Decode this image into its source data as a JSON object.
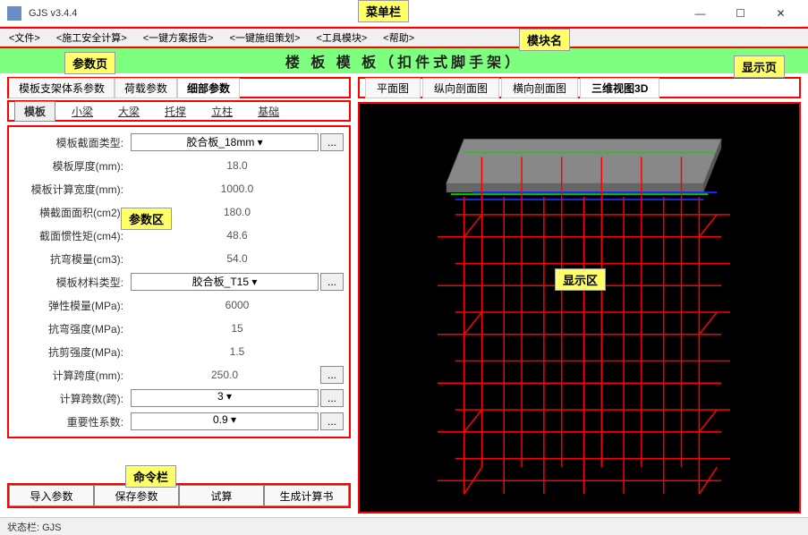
{
  "app": {
    "title": "GJS v3.4.4"
  },
  "window_controls": {
    "min": "—",
    "max": "☐",
    "close": "✕"
  },
  "menubar": {
    "items": [
      "<文件>",
      "<施工安全计算>",
      "<一键方案报告>",
      "<一键施组策划>",
      "<工具模块>",
      "<帮助>"
    ]
  },
  "module_name": "楼 板 模 板（扣件式脚手架）",
  "callouts": {
    "menubar": "菜单栏",
    "module_name": "模块名",
    "param_page": "参数页",
    "display_page": "显示页",
    "param_area": "参数区",
    "display_area": "显示区",
    "command_bar": "命令栏"
  },
  "param_tabs": {
    "items": [
      "模板支架体系参数",
      "荷载参数",
      "细部参数"
    ],
    "active": 2
  },
  "sub_tabs": {
    "items": [
      "模板",
      "小梁",
      "大梁",
      "托撑",
      "立柱",
      "基础"
    ],
    "active": 0
  },
  "params": {
    "rows": [
      {
        "label": "模板截面类型:",
        "value": "胶合板_18mm",
        "type": "select_dots"
      },
      {
        "label": "模板厚度(mm):",
        "value": "18.0",
        "type": "text"
      },
      {
        "label": "模板计算宽度(mm):",
        "value": "1000.0",
        "type": "text"
      },
      {
        "label": "横截面面积(cm2):",
        "value": "180.0",
        "type": "text"
      },
      {
        "label": "截面惯性矩(cm4):",
        "value": "48.6",
        "type": "text"
      },
      {
        "label": "抗弯模量(cm3):",
        "value": "54.0",
        "type": "text"
      },
      {
        "label": "模板材料类型:",
        "value": "胶合板_T15",
        "type": "select_dots"
      },
      {
        "label": "弹性模量(MPa):",
        "value": "6000",
        "type": "text"
      },
      {
        "label": "抗弯强度(MPa):",
        "value": "15",
        "type": "text"
      },
      {
        "label": "抗剪强度(MPa):",
        "value": "1.5",
        "type": "text"
      },
      {
        "label": "计算跨度(mm):",
        "value": "250.0",
        "type": "text_dots"
      },
      {
        "label": "计算跨数(跨):",
        "value": "3",
        "type": "select_dots"
      },
      {
        "label": "重要性系数:",
        "value": "0.9",
        "type": "select_dots"
      }
    ]
  },
  "commands": {
    "items": [
      "导入参数",
      "保存参数",
      "试算",
      "生成计算书"
    ]
  },
  "view_tabs": {
    "items": [
      "平面图",
      "纵向剖面图",
      "横向剖面图",
      "三维视图3D"
    ],
    "active": 3
  },
  "statusbar": {
    "text": "状态栏: GJS"
  }
}
